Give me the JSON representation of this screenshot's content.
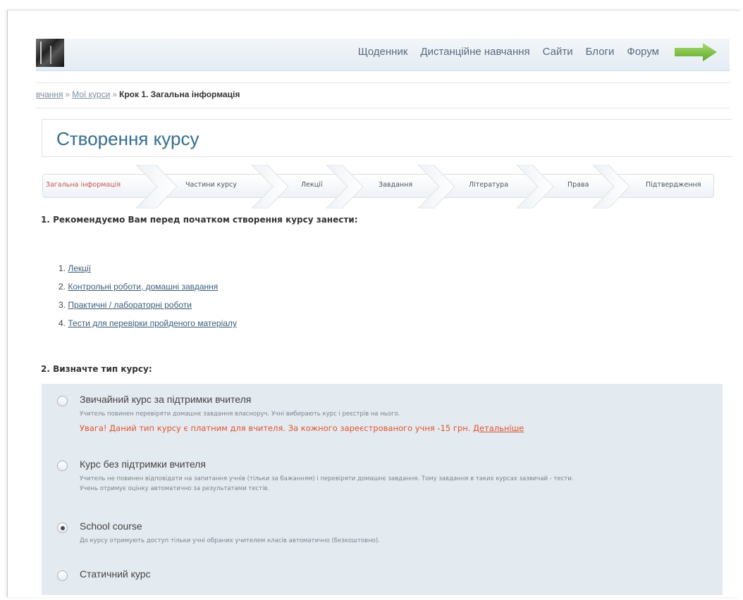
{
  "header": {
    "nav": [
      "Щоденник",
      "Дистанційне навчання",
      "Сайти",
      "Блоги",
      "Форум"
    ],
    "accent_color": "#7cc243"
  },
  "breadcrumb": {
    "items": [
      "вчання",
      "Мої курси"
    ],
    "separator": "»",
    "current": "Крок 1. Загальна інформація"
  },
  "page_title": "Створення курсу",
  "steps": {
    "items": [
      "Загальна інформація",
      "Частини курсу",
      "Лекції",
      "Завдання",
      "Література",
      "Права",
      "Підтвердження"
    ],
    "active_index": 0,
    "active_color": "#d9534f"
  },
  "section1": {
    "heading": "1. Рекомендуємо Вам перед початком створення курсу занести:",
    "items": [
      {
        "num": "1.",
        "label": "Лекції"
      },
      {
        "num": "2.",
        "label": "Контрольні роботи, домашні завдання"
      },
      {
        "num": "3.",
        "label": "Практичні / лабораторні роботи"
      },
      {
        "num": "4.",
        "label": "Тести для перевірки пройденого матеріалу"
      }
    ]
  },
  "section2": {
    "heading": "2. Визначте тип курсу:",
    "options": [
      {
        "title": "Звичайний курс за підтримки вчителя",
        "desc": "Учитель повинен перевіряти домашнє завдання власноруч. Учні вибирають курс і реєстрів на нього.",
        "warning": "Увага! Даний тип курсу є платним для вчителя. За кожного зареєстрованого учня -15 грн.",
        "warning_link": "Детальніше",
        "checked": false
      },
      {
        "title": "Курс без підтримки вчителя",
        "desc": "Учитель не повинен відповідати на запитання учнів (тільки за бажанням) і перевіряти домашнє завдання. Тому завдання в таких курсах зазвичай - тести.",
        "desc2": "Учень отримує оцінку автоматично за результатами тестів.",
        "checked": false
      },
      {
        "title": "School course",
        "desc": "До курсу отримують доступ тільки учні обраних учителем класів автоматично (безкоштовно).",
        "checked": true
      },
      {
        "title": "Статичний курс",
        "checked": false
      }
    ]
  }
}
